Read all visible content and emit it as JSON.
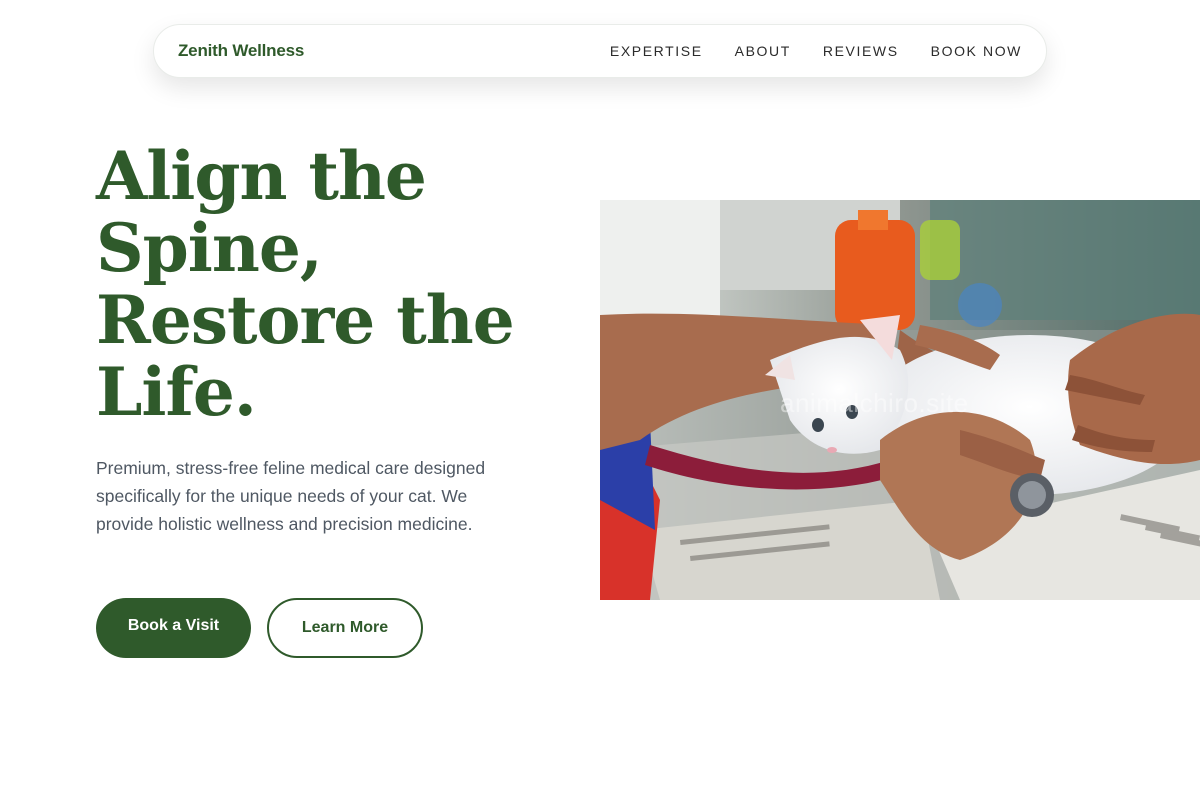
{
  "nav": {
    "brand": "Zenith Wellness",
    "links": [
      "EXPERTISE",
      "ABOUT",
      "REVIEWS",
      "BOOK NOW"
    ]
  },
  "hero": {
    "title_lines": [
      "Align the",
      "Spine,",
      "Restore the",
      "Life."
    ],
    "subtitle": "Premium, stress-free feline medical care designed specifically for the unique needs of your cat. We provide holistic wellness and precision medicine.",
    "primary_button": "Book a Visit",
    "secondary_button": "Learn More"
  },
  "image": {
    "watermark": "animalchiro.site"
  },
  "colors": {
    "accent": "#2f5a2b",
    "text_muted": "#4f5863"
  }
}
